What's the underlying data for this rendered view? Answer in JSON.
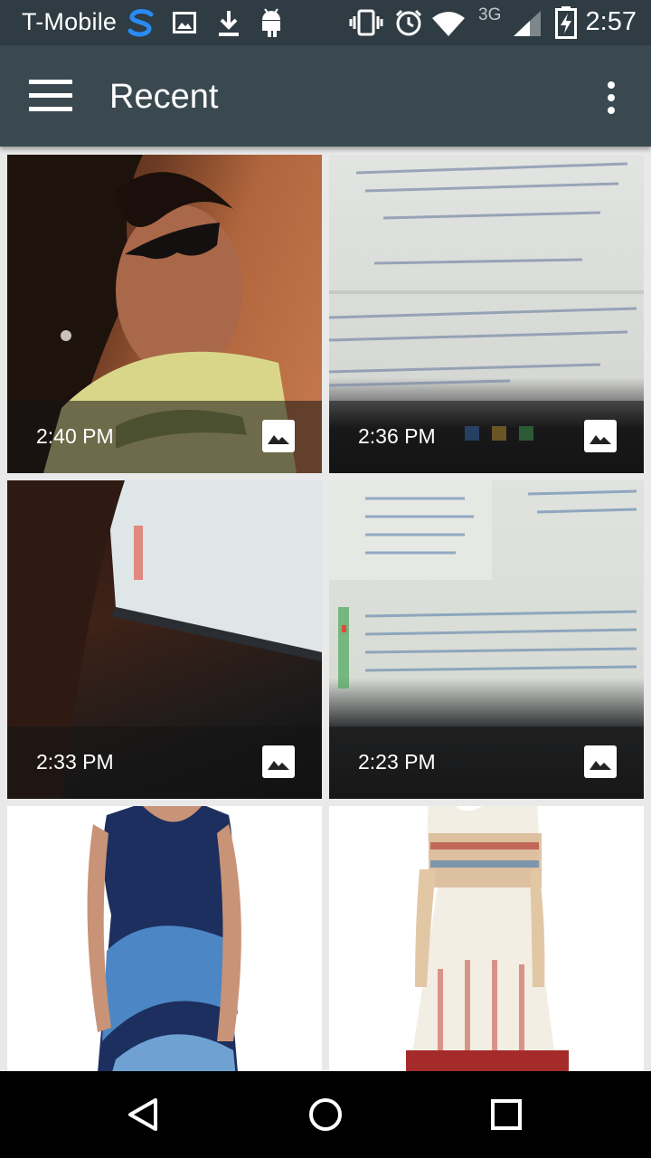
{
  "status_bar": {
    "carrier": "T-Mobile",
    "network": "3G",
    "time": "2:57",
    "icons": [
      "s-logo-icon",
      "image-icon",
      "download-icon",
      "android-icon",
      "vibrate-icon",
      "alarm-icon",
      "wifi-icon",
      "signal-icon",
      "battery-charging-icon"
    ]
  },
  "app_bar": {
    "title": "Recent",
    "menu_icon": "hamburger-menu-icon",
    "overflow_icon": "more-vertical-icon"
  },
  "photos": [
    {
      "time": "2:40 PM",
      "type_icon": "image-icon"
    },
    {
      "time": "2:36 PM",
      "type_icon": "image-icon"
    },
    {
      "time": "2:33 PM",
      "type_icon": "image-icon"
    },
    {
      "time": "2:23 PM",
      "type_icon": "image-icon"
    },
    {
      "time": "",
      "type_icon": ""
    },
    {
      "time": "",
      "type_icon": ""
    }
  ],
  "nav_bar": {
    "back_icon": "back-triangle-icon",
    "home_icon": "home-circle-icon",
    "recents_icon": "recents-square-icon"
  }
}
